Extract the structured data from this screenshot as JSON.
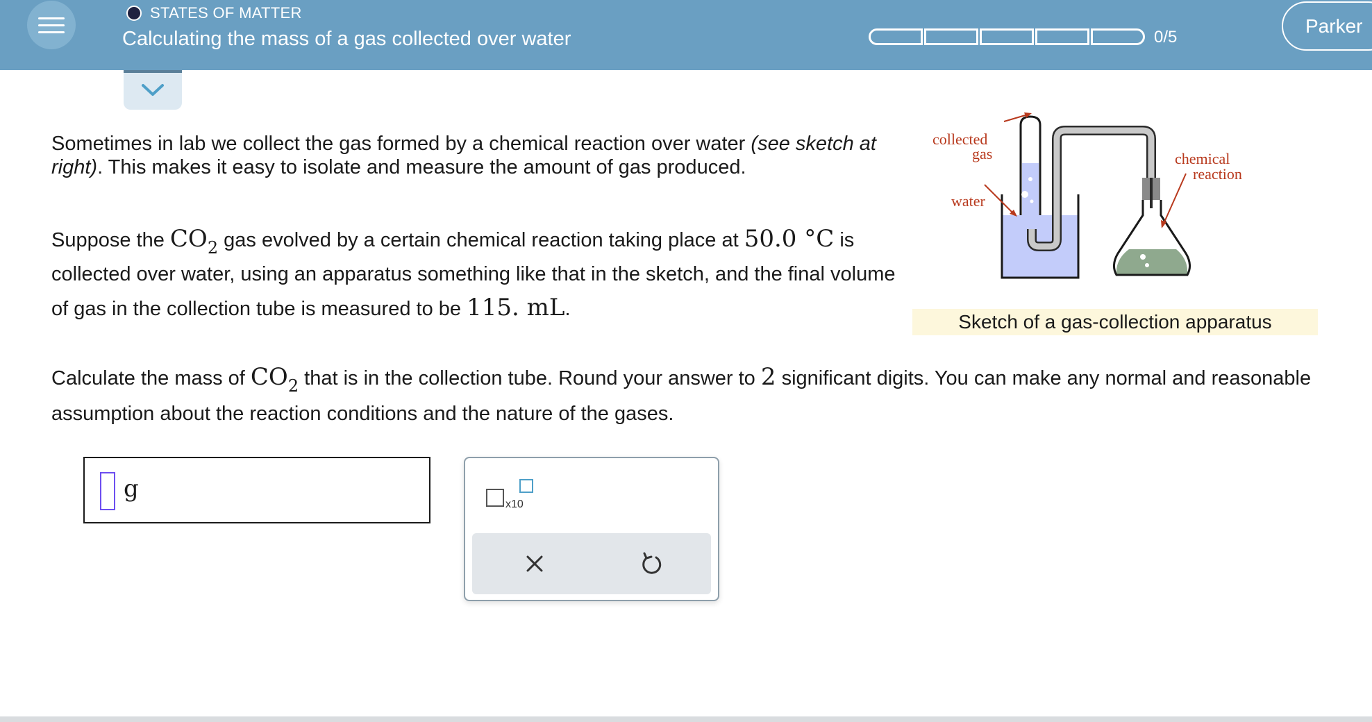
{
  "header": {
    "topic": "STATES OF MATTER",
    "title": "Calculating the mass of a gas collected over water",
    "progress_text": "0/5",
    "progress_segments": 5,
    "progress_filled": 0,
    "user_name": "Parker",
    "colors": {
      "bar": "#6a9fc2",
      "accent_dot": "#1f2140"
    }
  },
  "icons": {
    "menu": "hamburger-icon",
    "collapse": "chevron-down-icon",
    "clear": "x-icon",
    "undo": "undo-icon"
  },
  "problem": {
    "p1_a": "Sometimes in lab we collect the gas formed by a chemical reaction over water ",
    "p1_em": "(see sketch at right)",
    "p1_b": ". This makes it easy to isolate and measure the amount of gas produced.",
    "p2_a": "Suppose the ",
    "gas_formula": "CO",
    "gas_subscript": "2",
    "p2_b": " gas evolved by a certain chemical reaction taking place at ",
    "temperature": "50.0 °C",
    "p2_c": " is collected over water, using an apparatus something like that in the sketch, and the final volume of gas in the collection tube is measured to be ",
    "volume": "115. mL",
    "p2_d": ".",
    "p3_a": "Calculate the mass of ",
    "p3_b": " that is in the collection tube. Round your answer to ",
    "sig_figs": "2",
    "p3_c": " significant digits. You can make any normal and reasonable assumption about the reaction conditions and the nature of the gases."
  },
  "figure": {
    "label_collected": "collected",
    "label_gas": "gas",
    "label_water": "water",
    "label_chemical": "chemical",
    "label_reaction": "reaction",
    "caption": "Sketch of a gas-collection apparatus",
    "colors": {
      "water": "#c3ccfa",
      "reaction": "#8fa98e",
      "label": "#b8391d",
      "caption_bg": "#fdf7dc"
    }
  },
  "answer": {
    "value": "",
    "unit": "g"
  },
  "tools": {
    "sci_notation_label": "x10"
  }
}
